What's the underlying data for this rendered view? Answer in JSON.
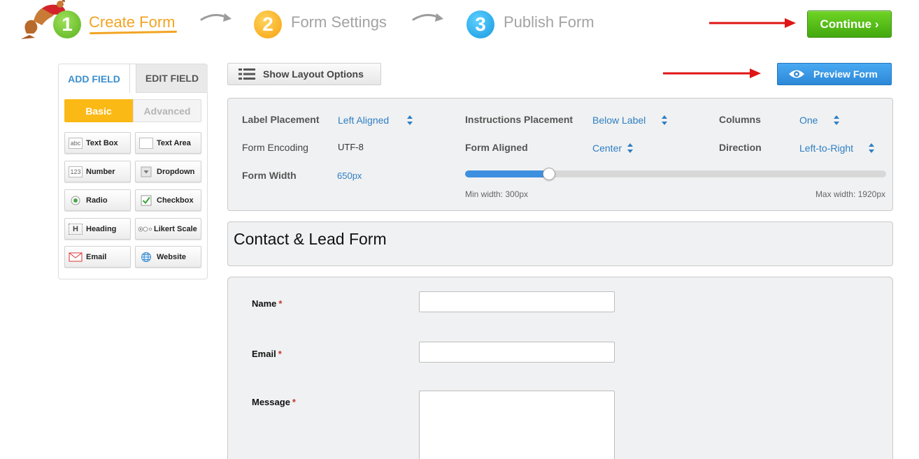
{
  "steps": {
    "step1": {
      "number": "1",
      "label": "Create Form"
    },
    "step2": {
      "number": "2",
      "label": "Form Settings"
    },
    "step3": {
      "number": "3",
      "label": "Publish Form"
    },
    "continue_label": "Continue ›"
  },
  "sidebar": {
    "tabs": {
      "add_field": "ADD FIELD",
      "edit_field": "EDIT FIELD"
    },
    "segments": {
      "basic": "Basic",
      "advanced": "Advanced"
    },
    "fields": [
      {
        "label": "Text Box",
        "icon_text": "abc"
      },
      {
        "label": "Text Area"
      },
      {
        "label": "Number",
        "icon_text": "123"
      },
      {
        "label": "Dropdown"
      },
      {
        "label": "Radio"
      },
      {
        "label": "Checkbox"
      },
      {
        "label": "Heading",
        "icon_text": "H"
      },
      {
        "label": "Likert Scale"
      },
      {
        "label": "Email"
      },
      {
        "label": "Website"
      }
    ]
  },
  "toolbar": {
    "layout_label": "Show Layout Options",
    "preview_label": "Preview Form"
  },
  "settings": {
    "label_placement": {
      "label": "Label Placement",
      "value": "Left Aligned"
    },
    "instructions_placement": {
      "label": "Instructions Placement",
      "value": "Below Label"
    },
    "columns": {
      "label": "Columns",
      "value": "One"
    },
    "form_encoding": {
      "label": "Form Encoding",
      "value": "UTF-8"
    },
    "form_aligned": {
      "label": "Form Aligned",
      "value": "Center"
    },
    "direction": {
      "label": "Direction",
      "value": "Left-to-Right"
    },
    "form_width": {
      "label": "Form Width",
      "value": "650px",
      "slider_fraction": 0.2
    },
    "min_width": "Min width: 300px",
    "max_width": "Max width: 1920px"
  },
  "form": {
    "title": "Contact & Lead Form",
    "fields": [
      {
        "label": "Name",
        "required": "*",
        "value": ""
      },
      {
        "label": "Email",
        "required": "*",
        "value": ""
      },
      {
        "label": "Message",
        "required": "*",
        "value": ""
      }
    ]
  },
  "colors": {
    "accent_orange": "#f2a423",
    "continue_green": "#4fb81a",
    "preview_blue": "#3096e6",
    "link_blue": "#2e7ec4",
    "arrow_red": "#e01515"
  }
}
